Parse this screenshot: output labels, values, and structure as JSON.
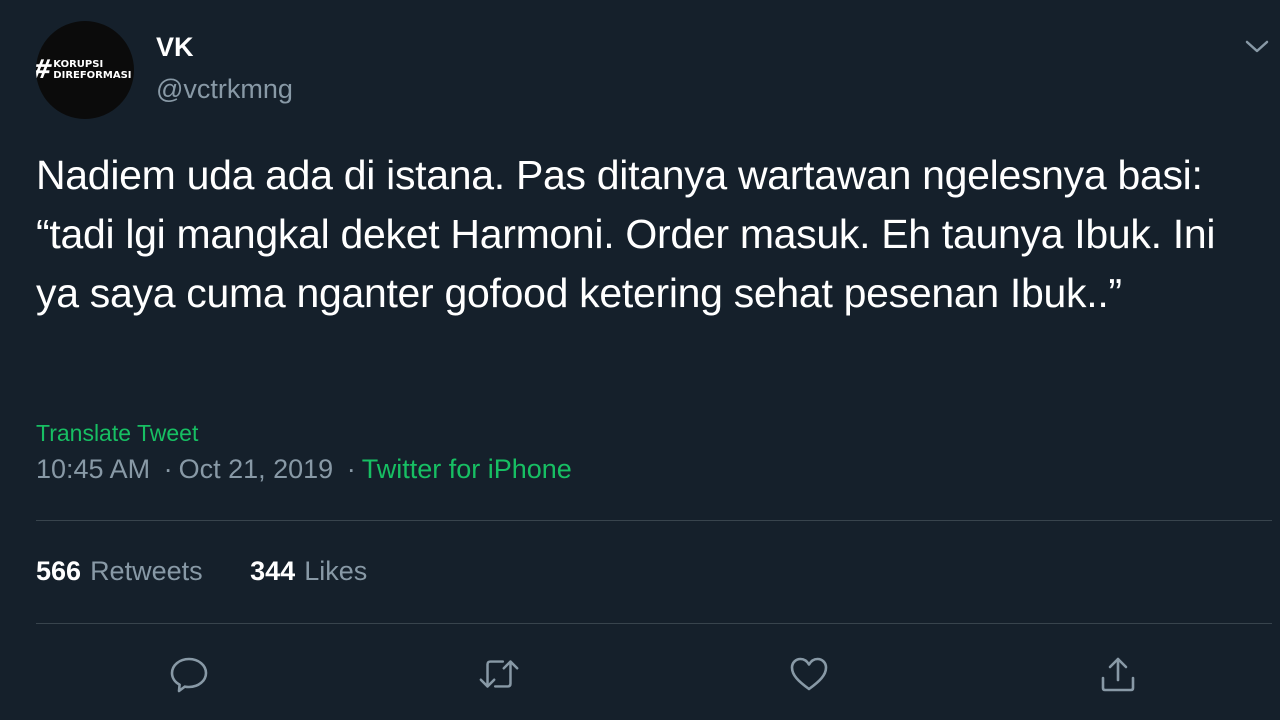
{
  "author": {
    "display_name": "VK",
    "handle": "@vctrkmng",
    "avatar": {
      "hash": "#",
      "line1": "KORUPSI",
      "line2": "DIREFORMASI"
    }
  },
  "tweet": {
    "text": "Nadiem uda ada di istana. Pas ditanya wartawan ngelesnya basi: “tadi lgi mangkal deket Harmoni. Order masuk. Eh taunya Ibuk. Ini ya saya cuma nganter gofood ketering sehat pesenan Ibuk..”",
    "translate_label": "Translate Tweet",
    "time": "10:45 AM",
    "separator": "·",
    "date": "Oct 21, 2019",
    "source": "Twitter for iPhone"
  },
  "stats": {
    "retweets_count": "566",
    "retweets_label": "Retweets",
    "likes_count": "344",
    "likes_label": "Likes"
  },
  "actions": [
    "reply-icon",
    "retweet-icon",
    "like-icon",
    "share-icon"
  ],
  "colors": {
    "background": "#15202b",
    "text": "#ffffff",
    "secondary": "#8899a6",
    "link": "#17bf63",
    "divider": "#38444d"
  }
}
